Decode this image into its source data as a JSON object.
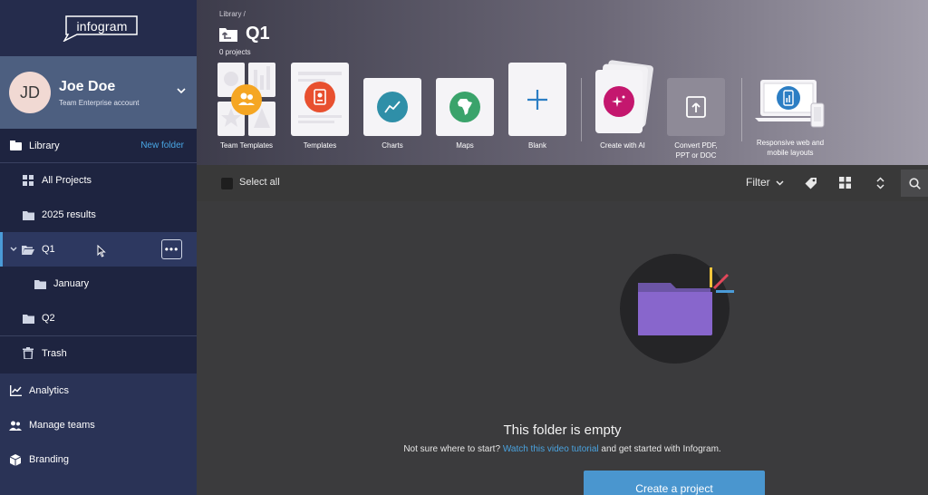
{
  "brand": {
    "logo_text": "infogram"
  },
  "user": {
    "initials": "JD",
    "name": "Joe Doe",
    "account": "Team Enterprise account"
  },
  "sidebar": {
    "library_label": "Library",
    "new_folder_label": "New folder",
    "tree": {
      "all_projects": "All Projects",
      "results_2025": "2025 results",
      "q1": "Q1",
      "january": "January",
      "q2": "Q2"
    },
    "trash_label": "Trash",
    "nav": {
      "analytics": "Analytics",
      "manage_teams": "Manage teams",
      "branding": "Branding"
    }
  },
  "header": {
    "breadcrumb": "Library /",
    "title": "Q1",
    "project_count": "0 projects",
    "tiles": {
      "team_templates": "Team Templates",
      "templates": "Templates",
      "charts": "Charts",
      "maps": "Maps",
      "blank": "Blank",
      "create_ai": "Create with AI",
      "convert_line1": "Convert PDF,",
      "convert_line2": "PPT or DOC",
      "responsive_line1": "Responsive web and",
      "responsive_line2": "mobile layouts"
    }
  },
  "toolbar": {
    "select_all": "Select all",
    "filter": "Filter"
  },
  "empty_state": {
    "title": "This folder is empty",
    "sub_before": "Not sure where to start? ",
    "sub_link": "Watch this video tutorial",
    "sub_after": " and get started with Infogram.",
    "cta": "Create a project"
  },
  "colors": {
    "sidebar_bg": "#1e2440",
    "accent_blue": "#4a96cf",
    "link_blue": "#4aa3df",
    "folder_purple": "#8866cc",
    "team_orange": "#f5a623",
    "templates_red": "#e8502f",
    "charts_teal": "#2f8fa8",
    "maps_green": "#3aa36b",
    "ai_magenta": "#c4176e"
  }
}
